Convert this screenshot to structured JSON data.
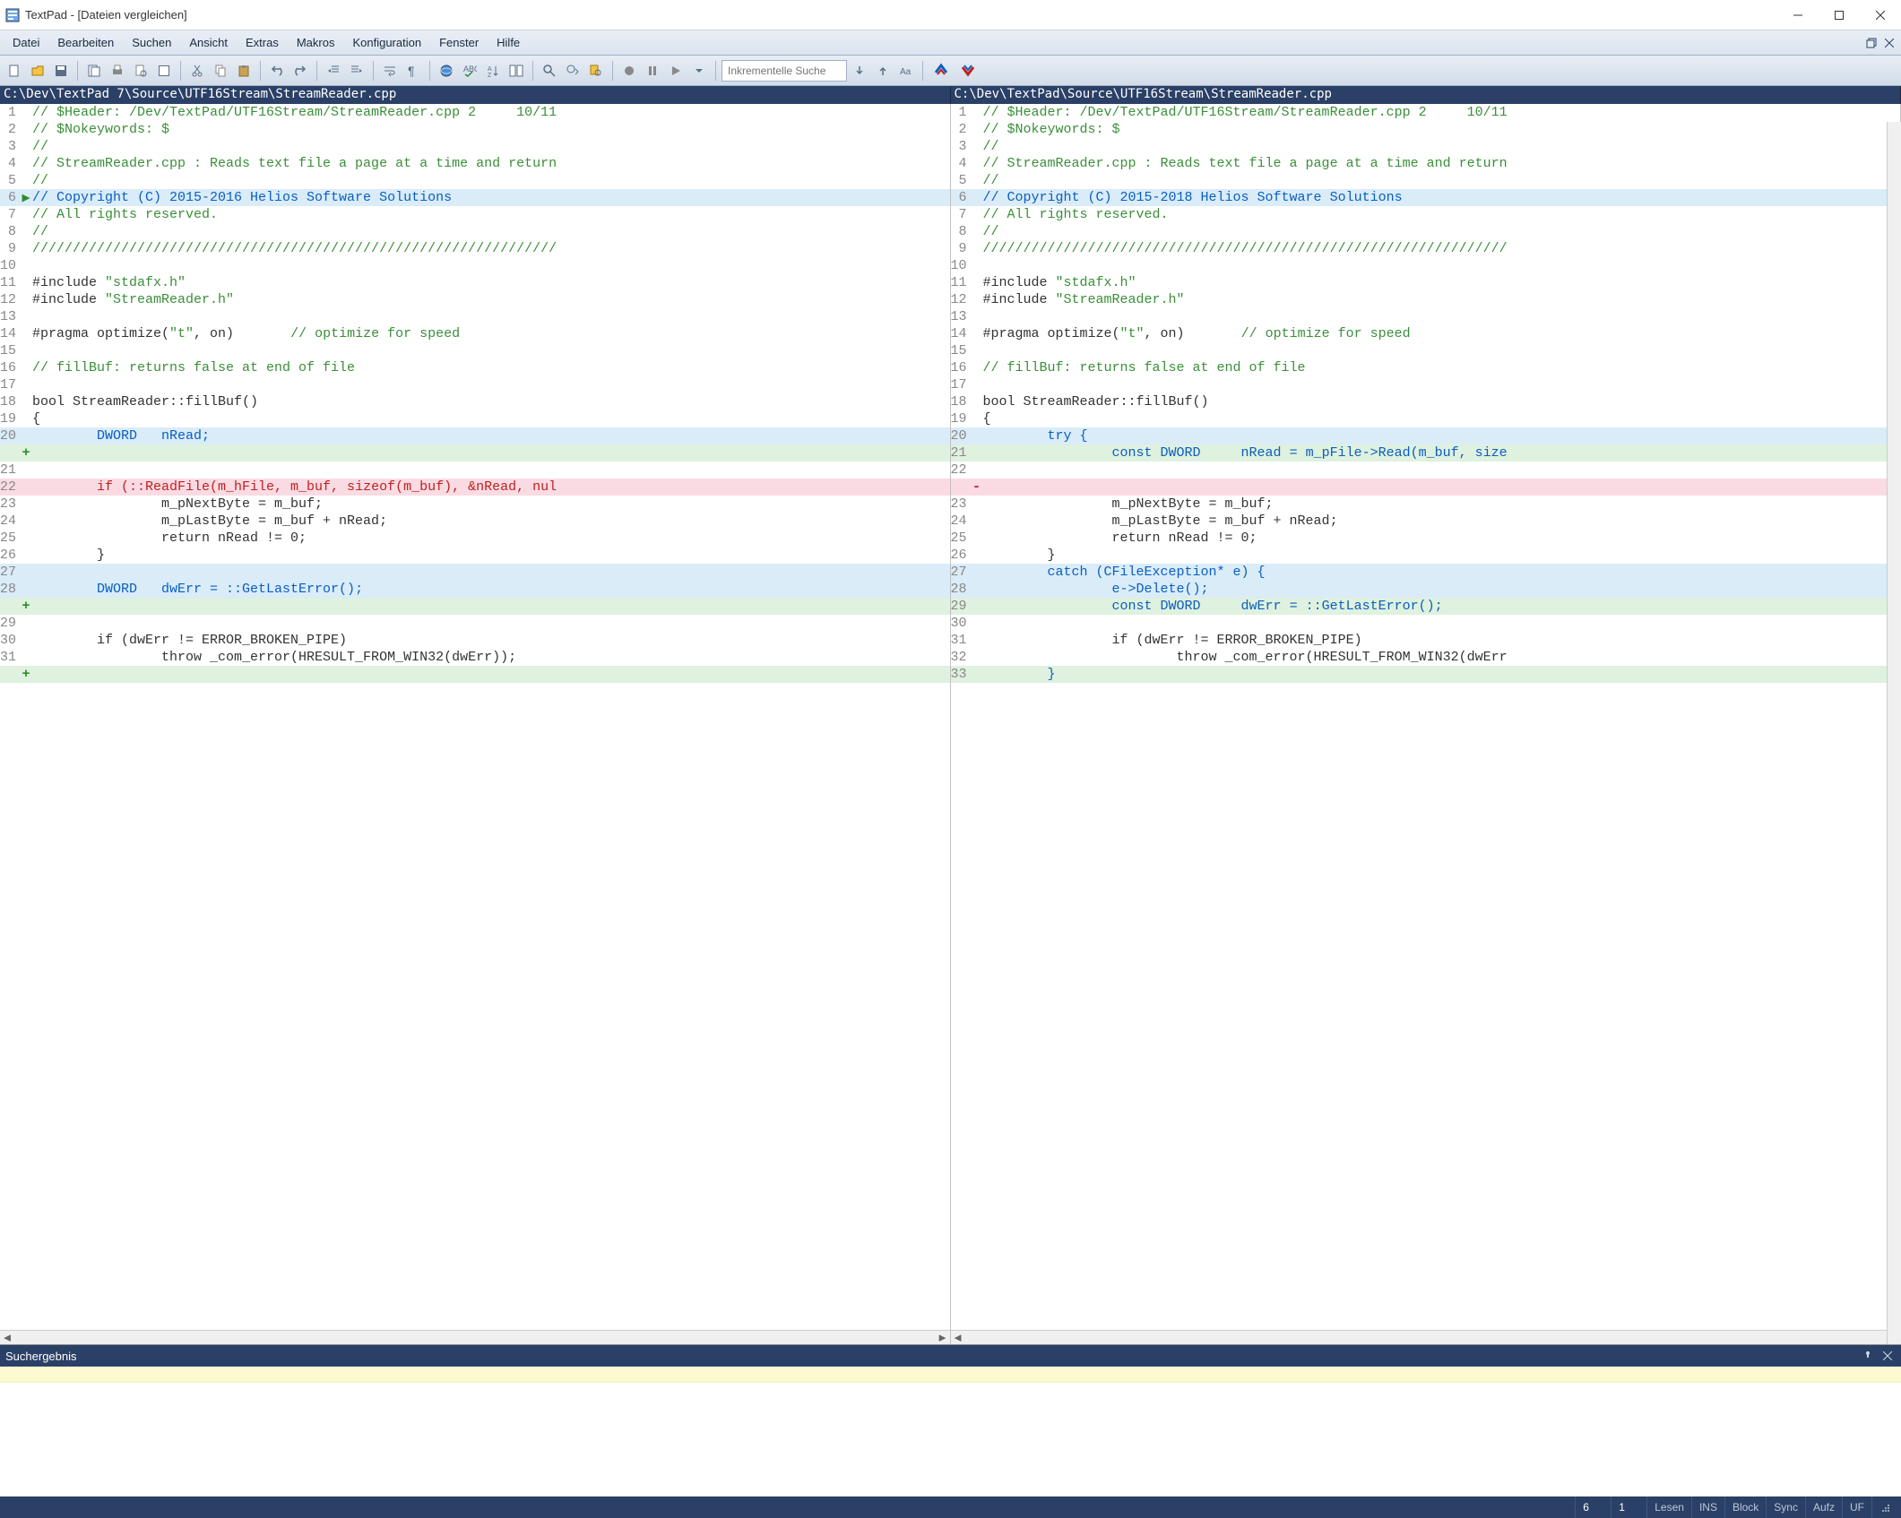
{
  "window": {
    "title": "TextPad - [Dateien vergleichen]"
  },
  "menu": {
    "items": [
      "Datei",
      "Bearbeiten",
      "Suchen",
      "Ansicht",
      "Extras",
      "Makros",
      "Konfiguration",
      "Fenster",
      "Hilfe"
    ]
  },
  "toolbar": {
    "search_placeholder": "Inkrementelle Suche"
  },
  "paths": {
    "left": "C:\\Dev\\TextPad 7\\Source\\UTF16Stream\\StreamReader.cpp",
    "right": "C:\\Dev\\TextPad\\Source\\UTF16Stream\\StreamReader.cpp"
  },
  "left_lines": [
    {
      "n": "1",
      "mk": "",
      "hl": "",
      "segs": [
        {
          "t": "// $Header: /Dev/TextPad/UTF16Stream/StreamReader.cpp 2     10/11",
          "c": "c-comment"
        }
      ]
    },
    {
      "n": "2",
      "mk": "",
      "hl": "",
      "segs": [
        {
          "t": "// $Nokeywords: $",
          "c": "c-comment"
        }
      ]
    },
    {
      "n": "3",
      "mk": "",
      "hl": "",
      "segs": [
        {
          "t": "//",
          "c": "c-comment"
        }
      ]
    },
    {
      "n": "4",
      "mk": "",
      "hl": "",
      "segs": [
        {
          "t": "// StreamReader.cpp : Reads text file a page at a time and return",
          "c": "c-comment"
        }
      ]
    },
    {
      "n": "5",
      "mk": "",
      "hl": "",
      "segs": [
        {
          "t": "//",
          "c": "c-comment"
        }
      ]
    },
    {
      "n": "6",
      "mk": "▶",
      "hl": "hl-blue",
      "segs": [
        {
          "t": "// Copyright (C) 2015-2016 Helios Software Solutions",
          "c": "c-keyword"
        }
      ]
    },
    {
      "n": "7",
      "mk": "",
      "hl": "",
      "segs": [
        {
          "t": "// All rights reserved.",
          "c": "c-comment"
        }
      ]
    },
    {
      "n": "8",
      "mk": "",
      "hl": "",
      "segs": [
        {
          "t": "//",
          "c": "c-comment"
        }
      ]
    },
    {
      "n": "9",
      "mk": "",
      "hl": "",
      "segs": [
        {
          "t": "/////////////////////////////////////////////////////////////////",
          "c": "c-comment"
        }
      ]
    },
    {
      "n": "10",
      "mk": "",
      "hl": "",
      "segs": []
    },
    {
      "n": "11",
      "mk": "",
      "hl": "",
      "segs": [
        {
          "t": "#include ",
          "c": "c-pre"
        },
        {
          "t": "\"stdafx.h\"",
          "c": "c-comment"
        }
      ]
    },
    {
      "n": "12",
      "mk": "",
      "hl": "",
      "segs": [
        {
          "t": "#include ",
          "c": "c-pre"
        },
        {
          "t": "\"StreamReader.h\"",
          "c": "c-comment"
        }
      ]
    },
    {
      "n": "13",
      "mk": "",
      "hl": "",
      "segs": []
    },
    {
      "n": "14",
      "mk": "",
      "hl": "",
      "segs": [
        {
          "t": "#pragma optimize(",
          "c": ""
        },
        {
          "t": "\"t\"",
          "c": "c-comment"
        },
        {
          "t": ", on)       ",
          "c": ""
        },
        {
          "t": "// optimize for speed",
          "c": "c-comment"
        }
      ]
    },
    {
      "n": "15",
      "mk": "",
      "hl": "",
      "segs": []
    },
    {
      "n": "16",
      "mk": "",
      "hl": "",
      "segs": [
        {
          "t": "// fillBuf: returns false at end of file",
          "c": "c-comment"
        }
      ]
    },
    {
      "n": "17",
      "mk": "",
      "hl": "",
      "segs": []
    },
    {
      "n": "18",
      "mk": "",
      "hl": "",
      "segs": [
        {
          "t": "bool StreamReader::fillBuf()",
          "c": ""
        }
      ]
    },
    {
      "n": "19",
      "mk": "",
      "hl": "",
      "segs": [
        {
          "t": "{",
          "c": ""
        }
      ]
    },
    {
      "n": "20",
      "mk": "",
      "hl": "hl-blue",
      "segs": [
        {
          "t": "        ",
          "c": ""
        },
        {
          "t": "DWORD   nRead;",
          "c": "c-keyword"
        }
      ]
    },
    {
      "n": "",
      "mk": "+",
      "hl": "hl-green",
      "segs": []
    },
    {
      "n": "21",
      "mk": "",
      "hl": "",
      "segs": []
    },
    {
      "n": "22",
      "mk": "",
      "hl": "hl-pink",
      "segs": [
        {
          "t": "        ",
          "c": ""
        },
        {
          "t": "if (::ReadFile(m_hFile, m_buf, sizeof(m_buf), &nRead, nul",
          "c": "c-red"
        }
      ]
    },
    {
      "n": "23",
      "mk": "",
      "hl": "",
      "segs": [
        {
          "t": "                m_pNextByte = m_buf;",
          "c": ""
        }
      ]
    },
    {
      "n": "24",
      "mk": "",
      "hl": "",
      "segs": [
        {
          "t": "                m_pLastByte = m_buf + nRead;",
          "c": ""
        }
      ]
    },
    {
      "n": "25",
      "mk": "",
      "hl": "",
      "segs": [
        {
          "t": "                return nRead != 0;",
          "c": ""
        }
      ]
    },
    {
      "n": "26",
      "mk": "",
      "hl": "",
      "segs": [
        {
          "t": "        }",
          "c": ""
        }
      ]
    },
    {
      "n": "27",
      "mk": "",
      "hl": "hl-blue",
      "segs": []
    },
    {
      "n": "28",
      "mk": "",
      "hl": "hl-blue",
      "segs": [
        {
          "t": "        ",
          "c": ""
        },
        {
          "t": "DWORD   dwErr = ::GetLastError();",
          "c": "c-keyword"
        }
      ]
    },
    {
      "n": "",
      "mk": "+",
      "hl": "hl-green",
      "segs": []
    },
    {
      "n": "29",
      "mk": "",
      "hl": "",
      "segs": []
    },
    {
      "n": "30",
      "mk": "",
      "hl": "",
      "segs": [
        {
          "t": "        if (dwErr != ERROR_BROKEN_PIPE)",
          "c": ""
        }
      ]
    },
    {
      "n": "31",
      "mk": "",
      "hl": "",
      "segs": [
        {
          "t": "                throw _com_error(HRESULT_FROM_WIN32(dwErr));",
          "c": ""
        }
      ]
    },
    {
      "n": "",
      "mk": "+",
      "hl": "hl-green",
      "segs": []
    }
  ],
  "right_lines": [
    {
      "n": "1",
      "mk": "",
      "hl": "",
      "segs": [
        {
          "t": "// $Header: /Dev/TextPad/UTF16Stream/StreamReader.cpp 2     10/11",
          "c": "c-comment"
        }
      ]
    },
    {
      "n": "2",
      "mk": "",
      "hl": "",
      "segs": [
        {
          "t": "// $Nokeywords: $",
          "c": "c-comment"
        }
      ]
    },
    {
      "n": "3",
      "mk": "",
      "hl": "",
      "segs": [
        {
          "t": "//",
          "c": "c-comment"
        }
      ]
    },
    {
      "n": "4",
      "mk": "",
      "hl": "",
      "segs": [
        {
          "t": "// StreamReader.cpp : Reads text file a page at a time and return",
          "c": "c-comment"
        }
      ]
    },
    {
      "n": "5",
      "mk": "",
      "hl": "",
      "segs": [
        {
          "t": "//",
          "c": "c-comment"
        }
      ]
    },
    {
      "n": "6",
      "mk": "",
      "hl": "hl-blue",
      "segs": [
        {
          "t": "// Copyright (C) 2015-2018 Helios Software Solutions",
          "c": "c-keyword"
        }
      ]
    },
    {
      "n": "7",
      "mk": "",
      "hl": "",
      "segs": [
        {
          "t": "// All rights reserved.",
          "c": "c-comment"
        }
      ]
    },
    {
      "n": "8",
      "mk": "",
      "hl": "",
      "segs": [
        {
          "t": "//",
          "c": "c-comment"
        }
      ]
    },
    {
      "n": "9",
      "mk": "",
      "hl": "",
      "segs": [
        {
          "t": "/////////////////////////////////////////////////////////////////",
          "c": "c-comment"
        }
      ]
    },
    {
      "n": "10",
      "mk": "",
      "hl": "",
      "segs": []
    },
    {
      "n": "11",
      "mk": "",
      "hl": "",
      "segs": [
        {
          "t": "#include ",
          "c": "c-pre"
        },
        {
          "t": "\"stdafx.h\"",
          "c": "c-comment"
        }
      ]
    },
    {
      "n": "12",
      "mk": "",
      "hl": "",
      "segs": [
        {
          "t": "#include ",
          "c": "c-pre"
        },
        {
          "t": "\"StreamReader.h\"",
          "c": "c-comment"
        }
      ]
    },
    {
      "n": "13",
      "mk": "",
      "hl": "",
      "segs": []
    },
    {
      "n": "14",
      "mk": "",
      "hl": "",
      "segs": [
        {
          "t": "#pragma optimize(",
          "c": ""
        },
        {
          "t": "\"t\"",
          "c": "c-comment"
        },
        {
          "t": ", on)       ",
          "c": ""
        },
        {
          "t": "// optimize for speed",
          "c": "c-comment"
        }
      ]
    },
    {
      "n": "15",
      "mk": "",
      "hl": "",
      "segs": []
    },
    {
      "n": "16",
      "mk": "",
      "hl": "",
      "segs": [
        {
          "t": "// fillBuf: returns false at end of file",
          "c": "c-comment"
        }
      ]
    },
    {
      "n": "17",
      "mk": "",
      "hl": "",
      "segs": []
    },
    {
      "n": "18",
      "mk": "",
      "hl": "",
      "segs": [
        {
          "t": "bool StreamReader::fillBuf()",
          "c": ""
        }
      ]
    },
    {
      "n": "19",
      "mk": "",
      "hl": "",
      "segs": [
        {
          "t": "{",
          "c": ""
        }
      ]
    },
    {
      "n": "20",
      "mk": "",
      "hl": "hl-blue",
      "segs": [
        {
          "t": "        ",
          "c": ""
        },
        {
          "t": "try {",
          "c": "c-keyword"
        }
      ]
    },
    {
      "n": "21",
      "mk": "",
      "hl": "hl-green",
      "segs": [
        {
          "t": "                ",
          "c": ""
        },
        {
          "t": "const DWORD     nRead = m_pFile->Read(m_buf, size",
          "c": "c-keyword"
        }
      ]
    },
    {
      "n": "22",
      "mk": "",
      "hl": "",
      "segs": []
    },
    {
      "n": "",
      "mk": "-",
      "hl": "hl-pink",
      "segs": []
    },
    {
      "n": "23",
      "mk": "",
      "hl": "",
      "segs": [
        {
          "t": "                m_pNextByte = m_buf;",
          "c": ""
        }
      ]
    },
    {
      "n": "24",
      "mk": "",
      "hl": "",
      "segs": [
        {
          "t": "                m_pLastByte = m_buf + nRead;",
          "c": ""
        }
      ]
    },
    {
      "n": "25",
      "mk": "",
      "hl": "",
      "segs": [
        {
          "t": "                return nRead != 0;",
          "c": ""
        }
      ]
    },
    {
      "n": "26",
      "mk": "",
      "hl": "",
      "segs": [
        {
          "t": "        }",
          "c": ""
        }
      ]
    },
    {
      "n": "27",
      "mk": "",
      "hl": "hl-blue",
      "segs": [
        {
          "t": "        ",
          "c": ""
        },
        {
          "t": "catch (CFileException* e) {",
          "c": "c-keyword"
        }
      ]
    },
    {
      "n": "28",
      "mk": "",
      "hl": "hl-blue",
      "segs": [
        {
          "t": "                ",
          "c": ""
        },
        {
          "t": "e->Delete();",
          "c": "c-keyword"
        }
      ]
    },
    {
      "n": "29",
      "mk": "",
      "hl": "hl-green",
      "segs": [
        {
          "t": "                ",
          "c": ""
        },
        {
          "t": "const DWORD     dwErr = ::GetLastError();",
          "c": "c-keyword"
        }
      ]
    },
    {
      "n": "30",
      "mk": "",
      "hl": "",
      "segs": []
    },
    {
      "n": "31",
      "mk": "",
      "hl": "",
      "segs": [
        {
          "t": "                if (dwErr != ERROR_BROKEN_PIPE)",
          "c": ""
        }
      ]
    },
    {
      "n": "32",
      "mk": "",
      "hl": "",
      "segs": [
        {
          "t": "                        throw _com_error(HRESULT_FROM_WIN32(dwErr",
          "c": ""
        }
      ]
    },
    {
      "n": "33",
      "mk": "",
      "hl": "hl-green",
      "segs": [
        {
          "t": "        ",
          "c": ""
        },
        {
          "t": "}",
          "c": "c-keyword"
        }
      ]
    }
  ],
  "search_panel": {
    "title": "Suchergebnis"
  },
  "status": {
    "line": "6",
    "col": "1",
    "cells": [
      "Lesen",
      "INS",
      "Block",
      "Sync",
      "Aufz",
      "UF"
    ]
  }
}
